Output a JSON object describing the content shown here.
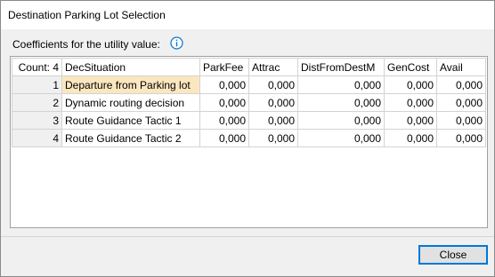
{
  "window": {
    "title": "Destination Parking Lot Selection"
  },
  "coefficients_label": "Coefficients for the utility value:",
  "info_icon": "info-icon",
  "table": {
    "count_header": "Count: 4",
    "columns": [
      "DecSituation",
      "ParkFee",
      "Attrac",
      "DistFromDestM",
      "GenCost",
      "Avail"
    ],
    "rows": [
      {
        "index": "1",
        "situation": "Departure from Parking lot",
        "values": [
          "0,000",
          "0,000",
          "0,000",
          "0,000",
          "0,000"
        ]
      },
      {
        "index": "2",
        "situation": "Dynamic routing decision",
        "values": [
          "0,000",
          "0,000",
          "0,000",
          "0,000",
          "0,000"
        ]
      },
      {
        "index": "3",
        "situation": "Route Guidance Tactic 1",
        "values": [
          "0,000",
          "0,000",
          "0,000",
          "0,000",
          "0,000"
        ]
      },
      {
        "index": "4",
        "situation": "Route Guidance Tactic 2",
        "values": [
          "0,000",
          "0,000",
          "0,000",
          "0,000",
          "0,000"
        ]
      }
    ]
  },
  "buttons": {
    "close_label": "Close"
  },
  "colors": {
    "accent": "#0078d7",
    "selection": "#fbe7bf",
    "info": "#0078d7"
  }
}
